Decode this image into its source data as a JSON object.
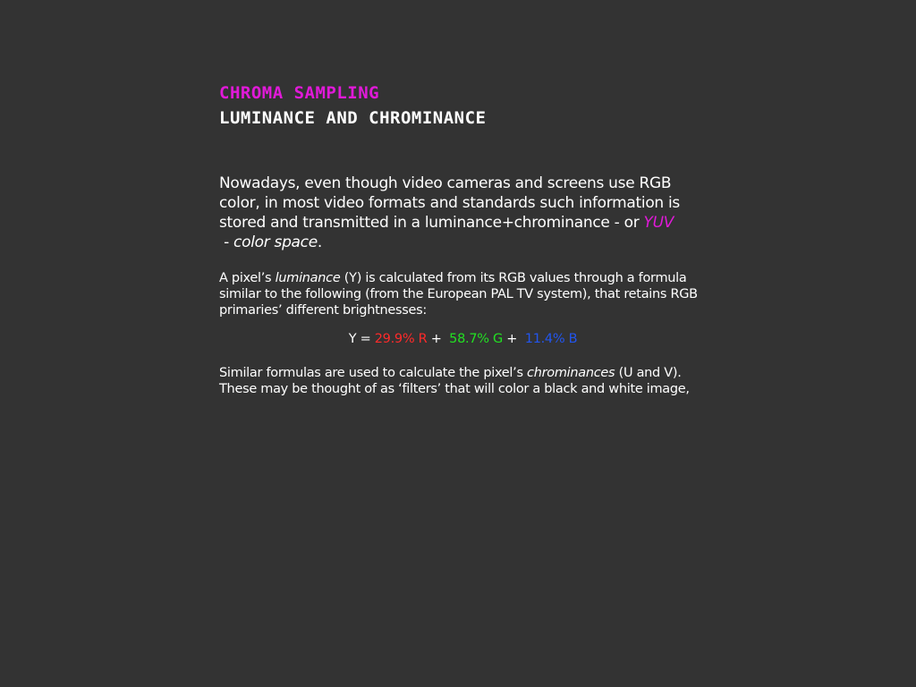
{
  "colors": {
    "background": "#333333",
    "accent": "#e01ad8",
    "red": "#ff2a2a",
    "green": "#22e022",
    "blue": "#2255ee"
  },
  "header": {
    "kicker": "Chroma sampling",
    "title": "Luminance and chrominance"
  },
  "lead": {
    "part1": "Nowadays, even though video cameras and screens use RGB color, in most video formats and standards such information is stored and transmitted in a luminance+chrominance - or ",
    "yuv": "YUV",
    "part2": " - ",
    "italic_end": "color space",
    "part3": "."
  },
  "para1": {
    "part1": "A pixel’s ",
    "italic": "luminance",
    "part2": " (Y) is calculated from its RGB values through a formula similar to the following (from the European PAL TV system), that retains RGB primaries’ different brightnesses:"
  },
  "formula": {
    "lhs": "Y = ",
    "r": "29.9% R",
    "plus1": " +  ",
    "g": "58.7% G",
    "plus2": " +  ",
    "b": "11.4% B"
  },
  "para2": {
    "part1": "Similar formulas are used to calculate the pixel’s ",
    "italic": "chrominances",
    "part2": " (U and V). These may be thought of as ‘filters’ that will color a black and white image,"
  }
}
